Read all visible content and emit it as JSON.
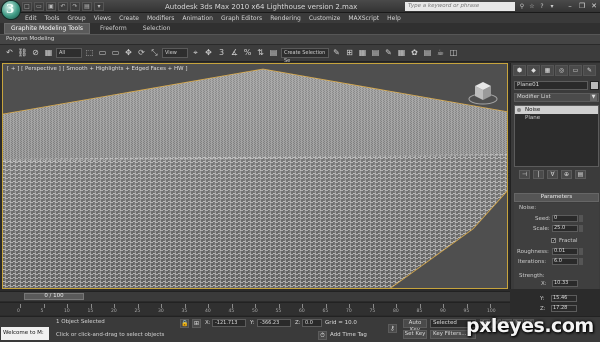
{
  "titlebar": {
    "title": "Autodesk 3ds Max  2010 x64     Lighthouse version 2.max",
    "logo_letter": "3",
    "search_placeholder": "Type a keyword or phrase",
    "quick_access": [
      "□",
      "▭",
      "▣",
      "↶",
      "↷",
      "▤",
      "▾"
    ],
    "title_icons": [
      "⚲",
      "☆",
      "?",
      "▾"
    ],
    "window_controls": [
      "–",
      "❐",
      "✕"
    ]
  },
  "menu": {
    "items": [
      "Edit",
      "Tools",
      "Group",
      "Views",
      "Create",
      "Modifiers",
      "Animation",
      "Graph Editors",
      "Rendering",
      "Customize",
      "MAXScript",
      "Help"
    ]
  },
  "ribbon": {
    "tabs": [
      "Graphite Modeling Tools",
      "Freeform",
      "Selection"
    ],
    "active_tab": 0,
    "panel_label": "Polygon Modeling"
  },
  "toolbar": {
    "filter_value": "All",
    "view_value": "View",
    "named_selection_placeholder": "Create Selection Se",
    "icons": [
      "↶",
      "⛓",
      "⊘",
      "▦",
      "⬚",
      "▭",
      "✥",
      "⟳",
      "⤡",
      "⌖",
      "3",
      "∡",
      "%",
      "⇅",
      "▤",
      "✎",
      "⊞",
      "▦",
      "✿",
      "▤",
      "☕",
      "◫"
    ]
  },
  "viewport": {
    "label": "[ + ] [ Perspective ] [ Smooth + Highlights + Edged Faces + HW ]"
  },
  "command_panel": {
    "tabs": [
      "⬢",
      "◆",
      "▦",
      "◎",
      "▭",
      "✎"
    ],
    "object_name": "Plane01",
    "object_color": "#b9b9b9",
    "modifier_list_label": "Modifier List",
    "stack": [
      {
        "label": "Noise",
        "selected": true
      },
      {
        "label": "Plane",
        "selected": false
      }
    ],
    "stack_tools": [
      "⊣",
      "|",
      "∀",
      "⊕",
      "▤"
    ],
    "parameters_title": "Parameters",
    "noise_label": "Noise:",
    "seed_label": "Seed:",
    "seed_value": "0",
    "scale_label": "Scale:",
    "scale_value": "25.0",
    "fractal_label": "Fractal",
    "fractal_checked": true,
    "roughness_label": "Roughness:",
    "roughness_value": "0.01",
    "iterations_label": "Iterations:",
    "iterations_value": "6.0",
    "strength_label": "Strength:",
    "strength_x_label": "X:",
    "strength_x": "10.33",
    "strength_y_label": "Y:",
    "strength_y": "15.46",
    "strength_z_label": "Z:",
    "strength_z": "17.28"
  },
  "timeline": {
    "frame_display": "0 / 100",
    "ticks": [
      "0",
      "5",
      "10",
      "15",
      "20",
      "25",
      "30",
      "35",
      "40",
      "45",
      "50",
      "55",
      "60",
      "65",
      "70",
      "75",
      "80",
      "85",
      "90",
      "95",
      "100"
    ]
  },
  "status": {
    "listener": "Welcome to M:",
    "line1": "1 Object Selected",
    "line2": "Click or click-and-drag to select objects",
    "x_label": "X:",
    "x_value": "-121.713",
    "y_label": "Y:",
    "y_value": "-366.23",
    "z_label": "Z:",
    "z_value": "0.0",
    "grid": "Grid = 10.0",
    "add_time_tag": "Add Time Tag",
    "auto_key": "Auto Key",
    "set_key": "Set Key",
    "selected_value": "Selected",
    "key_filters": "Key Filters...",
    "playback": [
      "|◀",
      "◀|",
      "▶",
      "|▶",
      "▶|"
    ]
  },
  "watermark": "pxleyes.com"
}
